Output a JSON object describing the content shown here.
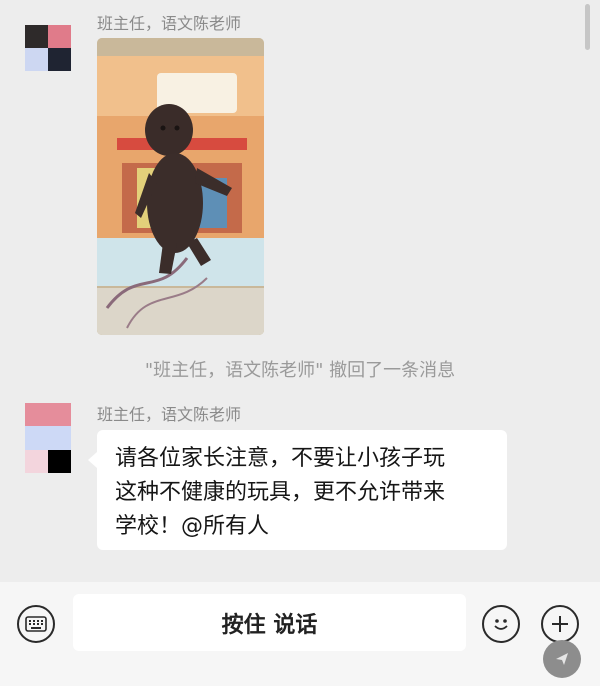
{
  "chat": {
    "messages": [
      {
        "sender": "班主任，语文陈老师",
        "type": "image",
        "image_desc_icon": "photo-doll-on-textbook"
      },
      {
        "type": "system",
        "text": "\"班主任，语文陈老师\" 撤回了一条消息"
      },
      {
        "sender": "班主任，语文陈老师",
        "type": "text",
        "lines": [
          "请各位家长注意，不要让小孩子玩",
          "这种不健康的玩具，更不允许带来",
          "学校！@所有人"
        ]
      }
    ]
  },
  "bottom_bar": {
    "keyboard_icon": "keyboard-icon",
    "hold_to_talk_label": "按住 说话",
    "emoji_icon": "emoji-icon",
    "plus_icon": "plus-icon"
  }
}
